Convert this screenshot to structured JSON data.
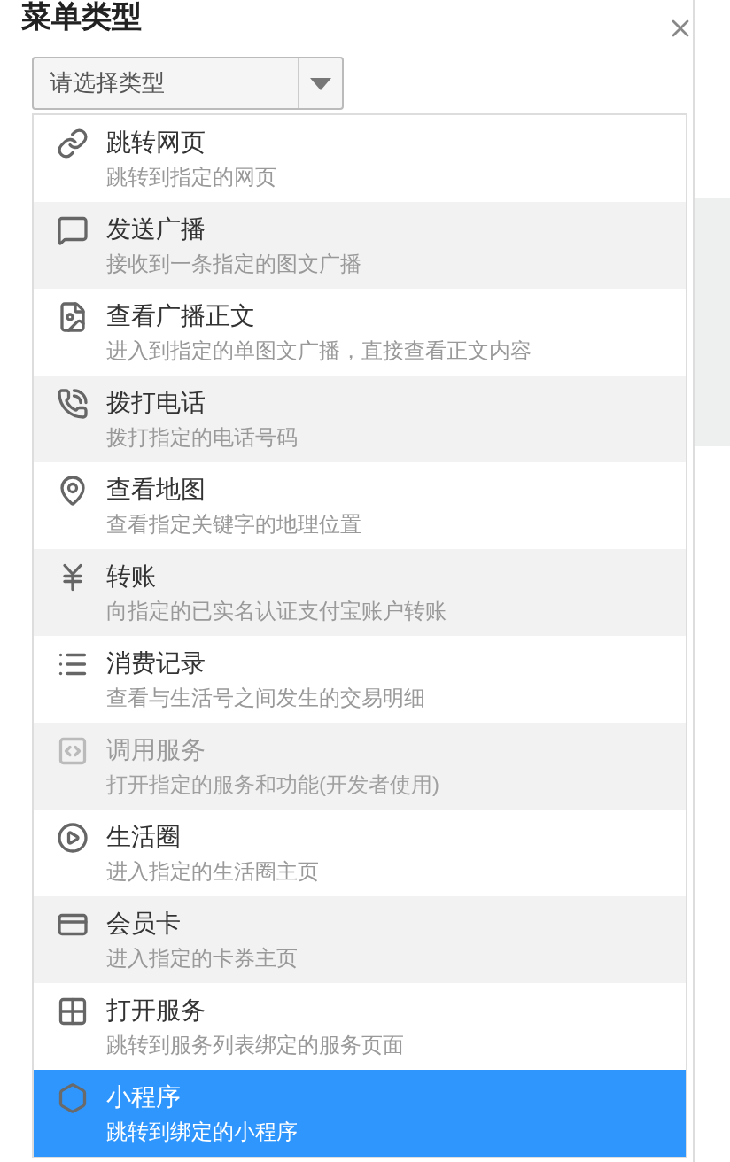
{
  "dialog": {
    "title": "菜单类型"
  },
  "select": {
    "placeholder": "请选择类型"
  },
  "options": [
    {
      "title": "跳转网页",
      "description": "跳转到指定的网页",
      "selected": false,
      "disabled": false
    },
    {
      "title": "发送广播",
      "description": "接收到一条指定的图文广播",
      "selected": false,
      "disabled": false
    },
    {
      "title": "查看广播正文",
      "description": "进入到指定的单图文广播，直接查看正文内容",
      "selected": false,
      "disabled": false
    },
    {
      "title": "拨打电话",
      "description": "拨打指定的电话号码",
      "selected": false,
      "disabled": false
    },
    {
      "title": "查看地图",
      "description": "查看指定关键字的地理位置",
      "selected": false,
      "disabled": false
    },
    {
      "title": "转账",
      "description": "向指定的已实名认证支付宝账户转账",
      "selected": false,
      "disabled": false
    },
    {
      "title": "消费记录",
      "description": "查看与生活号之间发生的交易明细",
      "selected": false,
      "disabled": false
    },
    {
      "title": "调用服务",
      "description": "打开指定的服务和功能(开发者使用)",
      "selected": false,
      "disabled": true
    },
    {
      "title": "生活圈",
      "description": "进入指定的生活圈主页",
      "selected": false,
      "disabled": false
    },
    {
      "title": "会员卡",
      "description": "进入指定的卡券主页",
      "selected": false,
      "disabled": false
    },
    {
      "title": "打开服务",
      "description": "跳转到服务列表绑定的服务页面",
      "selected": false,
      "disabled": false
    },
    {
      "title": "小程序",
      "description": "跳转到绑定的小程序",
      "selected": true,
      "disabled": false
    }
  ]
}
